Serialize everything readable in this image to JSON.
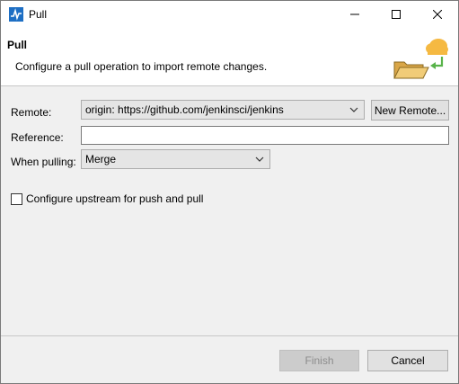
{
  "window": {
    "title": "Pull",
    "controls": {
      "minimize": "minimize",
      "maximize": "maximize",
      "close": "close"
    }
  },
  "banner": {
    "title": "Pull",
    "message": "Configure a pull operation to import remote changes."
  },
  "form": {
    "remote_label": "Remote:",
    "remote_value": "origin: https://github.com/jenkinsci/jenkins",
    "new_remote_button": "New Remote...",
    "reference_label": "Reference:",
    "reference_value": "",
    "when_pulling_label": "When pulling:",
    "when_pulling_value": "Merge",
    "upstream_checkbox_label": "Configure upstream for push and pull",
    "upstream_checked": false
  },
  "footer": {
    "finish_label": "Finish",
    "cancel_label": "Cancel"
  },
  "colors": {
    "dialog_bg": "#f0f0f0",
    "banner_bg": "#ffffff",
    "disabled_text": "#8d8d8d",
    "app_icon": "#1e6fc4",
    "cloud": "#f5b942",
    "arrow": "#58b34a"
  }
}
